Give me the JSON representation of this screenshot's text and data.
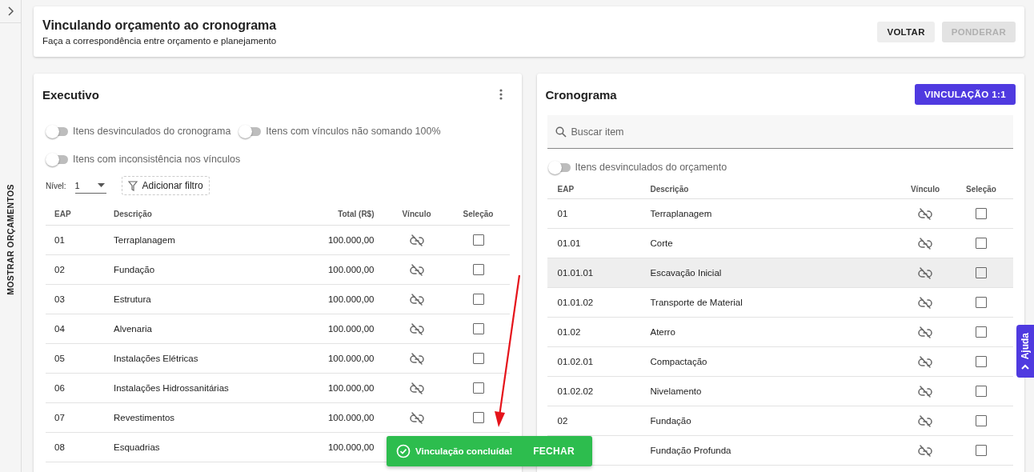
{
  "sidebar": {
    "label": "MOSTRAR ORÇAMENTOS"
  },
  "header": {
    "title": "Vinculando orçamento ao cronograma",
    "subtitle": "Faça a correspondência entre orçamento e planejamento",
    "buttons": [
      {
        "label": "VOLTAR",
        "disabled": false
      },
      {
        "label": "PONDERAR",
        "disabled": true
      }
    ]
  },
  "executivo": {
    "title": "Executivo",
    "toggles": [
      {
        "label": "Itens desvinculados do cronograma",
        "on": false
      },
      {
        "label": "Itens com vínculos não somando 100%",
        "on": false
      },
      {
        "label": "Itens com inconsistência nos vínculos",
        "on": false
      }
    ],
    "level": {
      "label": "Nível:",
      "value": "1"
    },
    "filter_button": "Adicionar filtro",
    "table": {
      "columns": [
        "EAP",
        "Descrição",
        "Total (R$)",
        "Vínculo",
        "Seleção"
      ],
      "rows": [
        {
          "eap": "01",
          "description": "Terraplanagem",
          "total": "100.000,00",
          "linked": false,
          "checked": false
        },
        {
          "eap": "02",
          "description": "Fundação",
          "total": "100.000,00",
          "linked": false,
          "checked": false
        },
        {
          "eap": "03",
          "description": "Estrutura",
          "total": "100.000,00",
          "linked": false,
          "checked": false
        },
        {
          "eap": "04",
          "description": "Alvenaria",
          "total": "100.000,00",
          "linked": false,
          "checked": false
        },
        {
          "eap": "05",
          "description": "Instalações Elétricas",
          "total": "100.000,00",
          "linked": false,
          "checked": false
        },
        {
          "eap": "06",
          "description": "Instalações Hidrossanitárias",
          "total": "100.000,00",
          "linked": false,
          "checked": false
        },
        {
          "eap": "07",
          "description": "Revestimentos",
          "total": "100.000,00",
          "linked": false,
          "checked": false
        },
        {
          "eap": "08",
          "description": "Esquadrias",
          "total": "100.000,00"
        }
      ]
    }
  },
  "cronograma": {
    "title": "Cronograma",
    "action_button": "VINCULAÇÃO 1:1",
    "search": {
      "placeholder": "Buscar item"
    },
    "toggles": [
      {
        "label": "Itens desvinculados do orçamento",
        "on": false
      }
    ],
    "table": {
      "columns": [
        "EAP",
        "Descrição",
        "Vínculo",
        "Seleção"
      ],
      "rows": [
        {
          "eap": "01",
          "description": "Terraplanagem",
          "linked": false,
          "checked": false,
          "highlighted": false
        },
        {
          "eap": "01.01",
          "description": "Corte",
          "linked": false,
          "checked": false,
          "highlighted": false
        },
        {
          "eap": "01.01.01",
          "description": "Escavação Inicial",
          "linked": false,
          "checked": false,
          "highlighted": true
        },
        {
          "eap": "01.01.02",
          "description": "Transporte de Material",
          "linked": false,
          "checked": false,
          "highlighted": false
        },
        {
          "eap": "01.02",
          "description": "Aterro",
          "linked": false,
          "checked": false,
          "highlighted": false
        },
        {
          "eap": "01.02.01",
          "description": "Compactação",
          "linked": false,
          "checked": false,
          "highlighted": false
        },
        {
          "eap": "01.02.02",
          "description": "Nivelamento",
          "linked": false,
          "checked": false,
          "highlighted": false
        },
        {
          "eap": "02",
          "description": "Fundação",
          "linked": false,
          "checked": false,
          "highlighted": false
        },
        {
          "description": "Fundação Profunda",
          "linked": false,
          "checked": false,
          "highlighted": false
        }
      ]
    }
  },
  "toast": {
    "message": "Vinculação concluída!",
    "action": "FECHAR"
  },
  "help_tab": {
    "label": "Ajuda"
  }
}
